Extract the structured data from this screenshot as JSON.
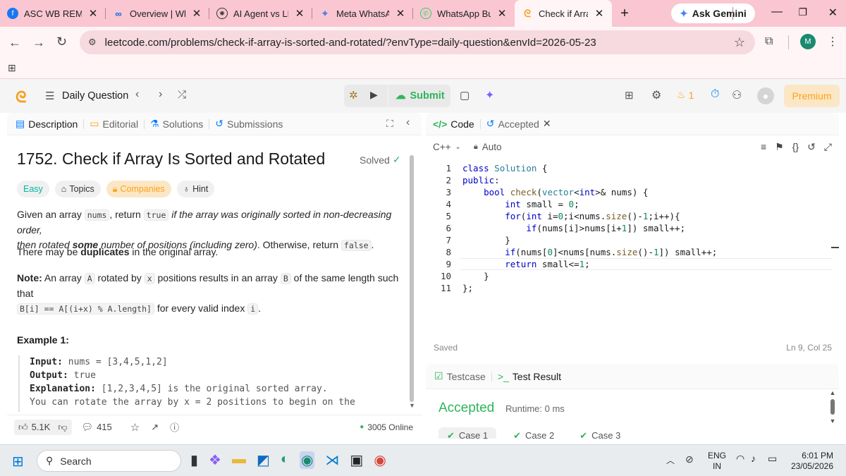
{
  "browser": {
    "tabs": [
      {
        "title": "ASC WB REMIN",
        "favicon": "facebook-icon"
      },
      {
        "title": "Overview | Wha",
        "favicon": "meta-icon"
      },
      {
        "title": "AI Agent vs LLM",
        "favicon": "openai-icon"
      },
      {
        "title": "Meta WhatsApp",
        "favicon": "gemini-icon"
      },
      {
        "title": "WhatsApp Busi",
        "favicon": "whatsapp-icon"
      },
      {
        "title": "Check if Array",
        "favicon": "leetcode-icon"
      }
    ],
    "new_tab": "+",
    "ask_gemini": "Ask Gemini",
    "url": "leetcode.com/problems/check-if-array-is-sorted-and-rotated/?envType=daily-question&envId=2026-05-23",
    "profile_initial": "M"
  },
  "header": {
    "daily_question": "Daily Question",
    "submit": "Submit",
    "streak": "1",
    "premium": "Premium"
  },
  "left": {
    "tabs": {
      "description": "Description",
      "editorial": "Editorial",
      "solutions": "Solutions",
      "submissions": "Submissions"
    },
    "title": "1752. Check if Array Is Sorted and Rotated",
    "solved": "Solved",
    "tags": {
      "easy": "Easy",
      "topics": "Topics",
      "companies": "Companies",
      "hint": "Hint"
    },
    "p1": {
      "a": "Given an array ",
      "nums": "nums",
      "b": ", return ",
      "true": "true",
      "c": " if the array was originally sorted in non-decreasing order,",
      "d": "then rotated ",
      "some": "some",
      "e": " number of positions (including zero)",
      "f": ". Otherwise, return ",
      "false": "false",
      "g": "."
    },
    "p2": {
      "a": "There may be ",
      "dup": "duplicates",
      "b": " in the original array."
    },
    "note": {
      "label": "Note:",
      "a": " An array ",
      "A": "A",
      "b": " rotated by ",
      "x": "x",
      "c": " positions results in an array ",
      "B": "B",
      "d": " of the same length such that",
      "expr": "B[i] == A[(i+x) % A.length]",
      "e": " for every valid index ",
      "i": "i",
      "f": "."
    },
    "example_title": "Example 1:",
    "example": {
      "input_label": "Input:",
      "input": " nums = [3,4,5,1,2]",
      "output_label": "Output:",
      "output": " true",
      "expl_label": "Explanation:",
      "expl": " [1,2,3,4,5] is the original sorted array.",
      "expl2": "You can rotate the array by x = 2 positions to begin on the"
    },
    "footer": {
      "likes": "5.1K",
      "comments": "415",
      "online": "3005 Online"
    }
  },
  "editor": {
    "tabs": {
      "code": "Code",
      "accepted": "Accepted"
    },
    "language": "C++",
    "mode": "Auto",
    "status": "Saved",
    "cursor": "Ln 9, Col 25",
    "lines": [
      "1",
      "2",
      "3",
      "4",
      "5",
      "6",
      "7",
      "8",
      "9",
      "10",
      "11"
    ]
  },
  "result": {
    "tabs": {
      "testcase": "Testcase",
      "result": "Test Result"
    },
    "status": "Accepted",
    "runtime": "Runtime: 0 ms",
    "cases": [
      "Case 1",
      "Case 2",
      "Case 3"
    ]
  },
  "taskbar": {
    "search": "Search",
    "lang1": "ENG",
    "lang2": "IN",
    "time": "6:01 PM",
    "date": "23/05/2026"
  },
  "colors": {
    "tabbar": "#f9c6d2",
    "accepted": "#2db55d",
    "easy": "#00b8a3",
    "companies": "#ffa116",
    "keyword": "#0000c8"
  }
}
